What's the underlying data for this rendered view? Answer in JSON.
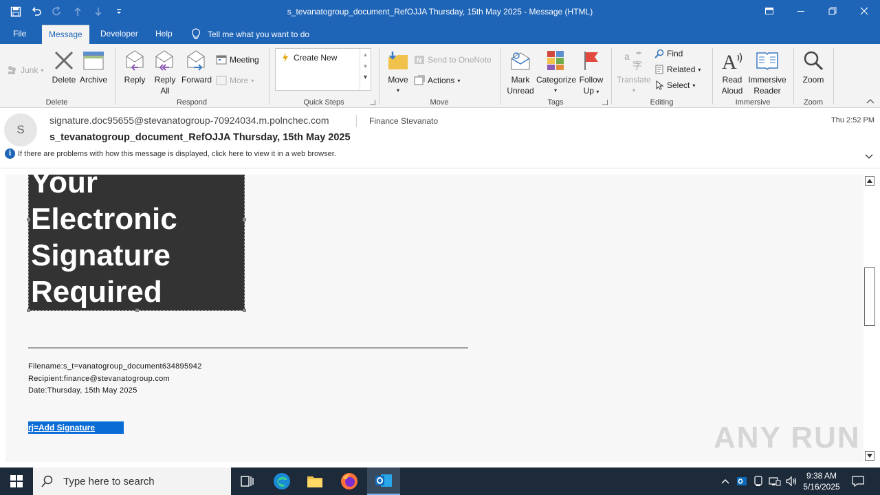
{
  "window": {
    "title": "s_tevanatogroup_document_RefOJJA Thursday, 15th May 2025  -  Message (HTML)"
  },
  "menu": {
    "tabs": [
      "File",
      "Message",
      "Developer",
      "Help"
    ],
    "tell_me": "Tell me what you want to do"
  },
  "ribbon": {
    "delete_group": {
      "junk": "Junk",
      "delete": "Delete",
      "archive": "Archive",
      "label": "Delete"
    },
    "respond_group": {
      "reply": "Reply",
      "reply_all_1": "Reply",
      "reply_all_2": "All",
      "forward": "Forward",
      "meeting": "Meeting",
      "more": "More",
      "label": "Respond"
    },
    "quick_steps": {
      "create_new": "Create New",
      "label": "Quick Steps"
    },
    "move_group": {
      "move": "Move",
      "onenote": "Send to OneNote",
      "actions": "Actions",
      "label": "Move"
    },
    "tags_group": {
      "mark_1": "Mark",
      "mark_2": "Unread",
      "categorize": "Categorize",
      "follow_1": "Follow",
      "follow_2": "Up",
      "label": "Tags"
    },
    "editing_group": {
      "translate": "Translate",
      "find": "Find",
      "related": "Related",
      "select": "Select",
      "label": "Editing"
    },
    "immersive_group": {
      "read_1": "Read",
      "read_2": "Aloud",
      "reader_1": "Immersive",
      "reader_2": "Reader",
      "label": "Immersive"
    },
    "zoom_group": {
      "zoom": "Zoom",
      "label": "Zoom"
    }
  },
  "message": {
    "avatar_initial": "S",
    "from": "signature.doc95655@stevanatogroup-70924034.m.polnchec.com",
    "to": "Finance Stevanato",
    "time": "Thu 2:52 PM",
    "subject": "s_tevanatogroup_document_RefOJJA Thursday, 15th May 2025",
    "info": "If there are problems with how this message is displayed, click here to view it in a web browser."
  },
  "body": {
    "banner_lines": [
      "Your",
      "Electronic",
      "Signature",
      "Required"
    ],
    "filename": "Filename:s_t=vanatogroup_document634895942",
    "recipient": "Recipient:finance@stevanatogroup.com",
    "date": "Date:Thursday, 15th May 2025",
    "link": "rj=Add Signature",
    "watermark": "ANY RUN"
  },
  "taskbar": {
    "search_placeholder": "Type here to search",
    "time": "9:38 AM",
    "date": "5/16/2025"
  },
  "colors": {
    "titlebar": "#1e64b7",
    "ribbon": "#f3f3f3",
    "banner": "#333333",
    "link_bg": "#0b6cd6",
    "taskbar": "#1c2a3a"
  }
}
